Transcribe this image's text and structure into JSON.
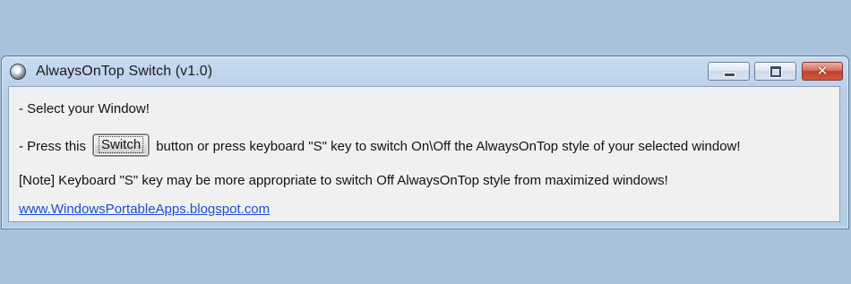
{
  "window": {
    "title": "AlwaysOnTop Switch (v1.0)",
    "icon": "app-globe-icon",
    "controls": {
      "minimize": "minimize-icon",
      "maximize": "maximize-icon",
      "close_glyph": "✕"
    }
  },
  "content": {
    "line1": "- Select your Window!",
    "line2_prefix": "- Press this",
    "switch_button_label": "Switch",
    "line2_suffix": "button or press keyboard \"S\" key to switch On\\Off the AlwaysOnTop style of your selected window!",
    "line3": "[Note] Keyboard \"S\" key may be more appropriate to switch Off AlwaysOnTop style from maximized windows!",
    "link": "www.WindowsPortableApps.blogspot.com"
  },
  "colors": {
    "desktop": "#a9c2dd",
    "link": "#1a4fd1",
    "close_button": "#c2402a"
  }
}
